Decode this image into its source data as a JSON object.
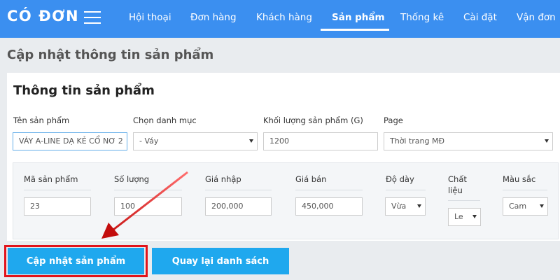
{
  "navbar": {
    "brand": "CÓ ĐƠN",
    "items": [
      {
        "label": "Hội thoại"
      },
      {
        "label": "Đơn hàng"
      },
      {
        "label": "Khách hàng"
      },
      {
        "label": "Sản phẩm",
        "active": true
      },
      {
        "label": "Thống kê"
      },
      {
        "label": "Cài đặt"
      },
      {
        "label": "Vận đơn"
      }
    ]
  },
  "page": {
    "title": "Cập nhật thông tin sản phẩm",
    "card_title": "Thông tin sản phẩm"
  },
  "product": {
    "name_label": "Tên sản phẩm",
    "name_value": "VÁY A-LINE DẠ KẺ CỔ NƠ 2",
    "category_label": "Chọn danh mục",
    "category_value": "- Váy",
    "weight_label": "Khối lượng sản phẩm (G)",
    "weight_value": "1200",
    "page_label": "Page",
    "page_value": "Thời trang MĐ"
  },
  "variant": {
    "code_label": "Mã sản phẩm",
    "code_value": "23",
    "qty_label": "Số lượng",
    "qty_value": "100",
    "cost_label": "Giá nhập",
    "cost_value": "200,000",
    "price_label": "Giá bán",
    "price_value": "450,000",
    "thickness_label": "Độ dày",
    "thickness_value": "Vừa",
    "material_label_line1": "Chất",
    "material_label_line2": "liệu",
    "material_value": "Le",
    "color_label": "Màu sắc",
    "color_value": "Cam"
  },
  "buttons": {
    "update": "Cập nhật sản phẩm",
    "back": "Quay lại danh sách"
  },
  "colors": {
    "navbar": "#3b8ff0",
    "button": "#1fa8ee",
    "highlight": "#e2141b"
  }
}
